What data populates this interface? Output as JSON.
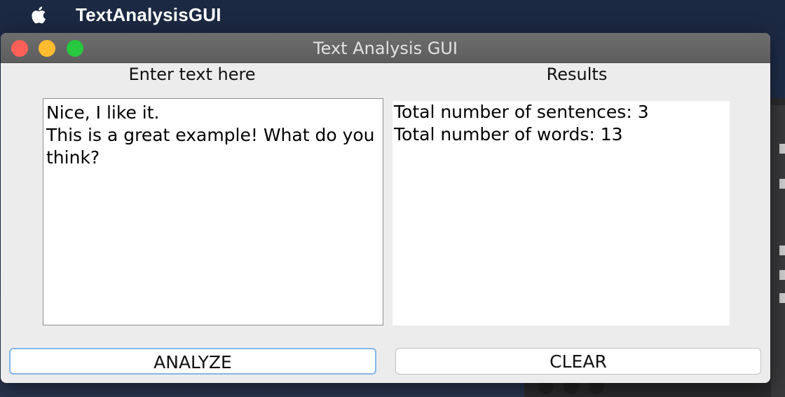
{
  "menubar": {
    "app_name": "TextAnalysisGUI",
    "icon": "apple-icon"
  },
  "window": {
    "title": "Text Analysis GUI"
  },
  "input": {
    "label": "Enter text here",
    "value": "Nice, I like it.\nThis is a great example! What do you think?"
  },
  "results": {
    "label": "Results",
    "lines": [
      "Total number of sentences: 3",
      "Total number of words: 13"
    ]
  },
  "buttons": {
    "analyze": "ANALYZE",
    "clear": "CLEAR"
  },
  "colors": {
    "close": "#fe5f57",
    "minimize": "#febc2e",
    "zoom": "#28c840",
    "focus_ring": "#86b6ea"
  }
}
